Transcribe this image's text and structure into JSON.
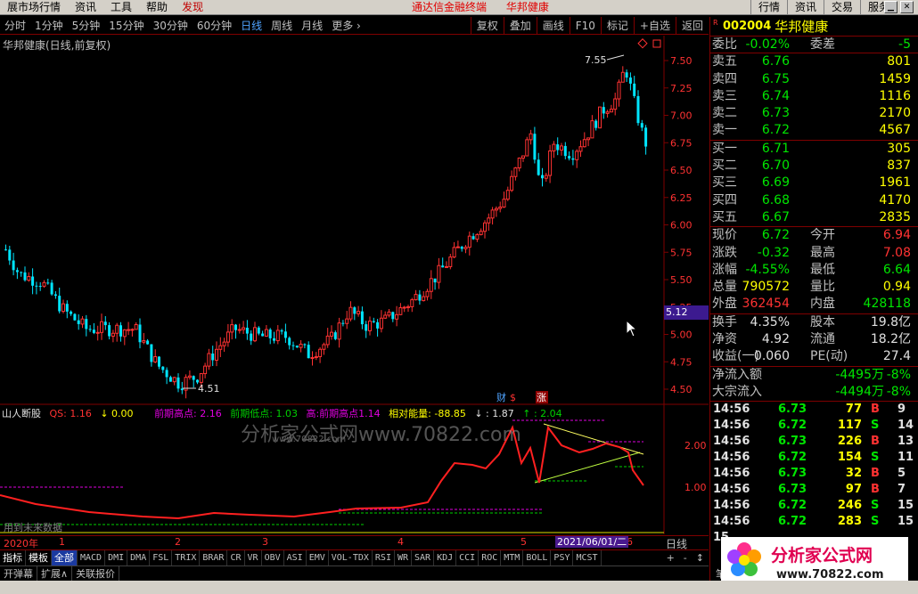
{
  "menu": {
    "items": [
      "展市场行情",
      "资讯",
      "工具",
      "帮助",
      "发现"
    ],
    "center": [
      "通达信金融终端",
      "华邦健康"
    ],
    "right": [
      "行情",
      "资讯",
      "交易",
      "服务"
    ]
  },
  "toolbar": {
    "periods": [
      "分时",
      "1分钟",
      "5分钟",
      "15分钟",
      "30分钟",
      "60分钟",
      "日线",
      "周线",
      "月线",
      "更多 ›"
    ],
    "active": "日线",
    "buttons": [
      "复权",
      "叠加",
      "画线",
      "F10",
      "标记",
      "+自选",
      "返回"
    ]
  },
  "chart": {
    "title": "华邦健康(日线,前复权)",
    "high_label": "7.55",
    "low_label": "4.51",
    "current_price_tag": "5.12",
    "y_ticks": [
      "7.50",
      "7.25",
      "7.00",
      "6.75",
      "6.50",
      "6.25",
      "6.00",
      "5.75",
      "5.50",
      "5.25",
      "5.00",
      "4.75",
      "4.50"
    ],
    "markers": [
      "财",
      "$",
      "涨"
    ]
  },
  "indicator": {
    "name": "山人断股",
    "qs_label": "QS: 1.16",
    "arrow_val": "↓ 0.00",
    "prev_high": "前期高点: 2.16",
    "prev_low": "前期低点: 1.03",
    "mid": "高:前期高点1.14",
    "energy": "相对能量: -88.85",
    "v1": "↓ : 1.87",
    "v2": "↑ : 2.04",
    "y_ticks": [
      "2.00",
      "1.00"
    ],
    "watermark": "分析家公式网www.70822.com",
    "watermark2": "www.70822.com",
    "future_note": "用到未来数据"
  },
  "xaxis": {
    "year": "2020年",
    "months": [
      "1",
      "2",
      "3",
      "4",
      "5",
      "6"
    ],
    "date_flag": "2021/06/01/二",
    "period": "日线"
  },
  "tabs": [
    "指标",
    "模板",
    "全部",
    "MACD",
    "DMI",
    "DMA",
    "FSL",
    "TRIX",
    "BRAR",
    "CR",
    "VR",
    "OBV",
    "ASI",
    "EMV",
    "VOL-TDX",
    "RSI",
    "WR",
    "SAR",
    "KDJ",
    "CCI",
    "ROC",
    "MTM",
    "BOLL",
    "PSY",
    "MCST"
  ],
  "tabs_right": [
    "+",
    "-",
    "↕"
  ],
  "bottom": [
    "开弹幕",
    "扩展∧",
    "关联报价"
  ],
  "quote": {
    "code": "002004",
    "name": "华邦健康",
    "webi": {
      "label": "委比",
      "value": "-0.02%",
      "label2": "委差",
      "value2": "-5"
    },
    "asks": [
      {
        "label": "卖五",
        "price": "6.76",
        "vol": "801"
      },
      {
        "label": "卖四",
        "price": "6.75",
        "vol": "1459"
      },
      {
        "label": "卖三",
        "price": "6.74",
        "vol": "1116"
      },
      {
        "label": "卖二",
        "price": "6.73",
        "vol": "2170"
      },
      {
        "label": "卖一",
        "price": "6.72",
        "vol": "4567"
      }
    ],
    "bids": [
      {
        "label": "买一",
        "price": "6.71",
        "vol": "305"
      },
      {
        "label": "买二",
        "price": "6.70",
        "vol": "837"
      },
      {
        "label": "买三",
        "price": "6.69",
        "vol": "1961"
      },
      {
        "label": "买四",
        "price": "6.68",
        "vol": "4170"
      },
      {
        "label": "买五",
        "price": "6.67",
        "vol": "2835"
      }
    ],
    "stats": [
      {
        "l1": "现价",
        "v1": "6.72",
        "c1": "green",
        "l2": "今开",
        "v2": "6.94",
        "c2": "red"
      },
      {
        "l1": "涨跌",
        "v1": "-0.32",
        "c1": "green",
        "l2": "最高",
        "v2": "7.08",
        "c2": "red"
      },
      {
        "l1": "涨幅",
        "v1": "-4.55%",
        "c1": "green",
        "l2": "最低",
        "v2": "6.64",
        "c2": "green"
      },
      {
        "l1": "总量",
        "v1": "790572",
        "c1": "yellow",
        "l2": "量比",
        "v2": "0.94",
        "c2": "yellow"
      },
      {
        "l1": "外盘",
        "v1": "362454",
        "c1": "red",
        "l2": "内盘",
        "v2": "428118",
        "c2": "green"
      }
    ],
    "fund": [
      {
        "l1": "换手",
        "v1": "4.35%",
        "l2": "股本",
        "v2": "19.8亿"
      },
      {
        "l1": "净资",
        "v1": "4.92",
        "l2": "流通",
        "v2": "18.2亿"
      },
      {
        "l1": "收益(一)",
        "v1": "0.060",
        "l2": "PE(动)",
        "v2": "27.4"
      }
    ],
    "flow": [
      {
        "label": "净流入额",
        "value": "-4495万",
        "pct": "-8%"
      },
      {
        "label": "大宗流入",
        "value": "-4494万",
        "pct": "-8%"
      }
    ],
    "ticks": [
      {
        "t": "14:56",
        "p": "6.73",
        "v": "77",
        "bs": "B",
        "n": "9"
      },
      {
        "t": "14:56",
        "p": "6.72",
        "v": "117",
        "bs": "S",
        "n": "14"
      },
      {
        "t": "14:56",
        "p": "6.73",
        "v": "226",
        "bs": "B",
        "n": "13"
      },
      {
        "t": "14:56",
        "p": "6.72",
        "v": "154",
        "bs": "S",
        "n": "11"
      },
      {
        "t": "14:56",
        "p": "6.73",
        "v": "32",
        "bs": "B",
        "n": "5"
      },
      {
        "t": "14:56",
        "p": "6.73",
        "v": "97",
        "bs": "B",
        "n": "7"
      },
      {
        "t": "14:56",
        "p": "6.72",
        "v": "246",
        "bs": "S",
        "n": "15"
      },
      {
        "t": "14:56",
        "p": "6.72",
        "v": "283",
        "bs": "S",
        "n": "15"
      },
      {
        "t": "15",
        "p": "",
        "v": "",
        "bs": "",
        "n": ""
      }
    ],
    "bottom_left": "笔"
  },
  "logo": {
    "text": "分析家公式网",
    "url": "www.70822.com"
  },
  "colors": {
    "up": "#ff3232",
    "down": "#00e5ff",
    "bg": "#000000",
    "frame": "#7f0000"
  }
}
